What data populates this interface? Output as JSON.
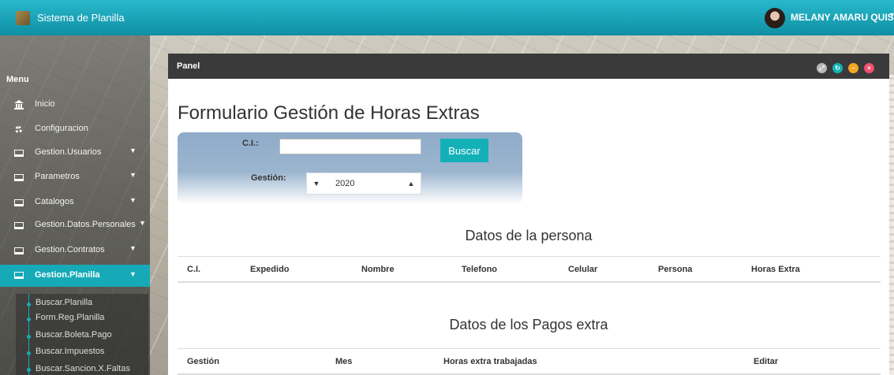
{
  "app": {
    "title": "Sistema de Planilla"
  },
  "user": {
    "name": "MELANY AMARU QUISPE"
  },
  "sidebar": {
    "heading": "Menu",
    "items": [
      {
        "label": "Inicio",
        "icon": "bank-icon",
        "has_caret": false
      },
      {
        "label": "Configuracion",
        "icon": "gear-icon",
        "has_caret": false
      },
      {
        "label": "Gestion.Usuarios",
        "icon": "laptop-icon",
        "has_caret": true
      },
      {
        "label": "Parametros",
        "icon": "laptop-icon",
        "has_caret": true
      },
      {
        "label": "Catalogos",
        "icon": "laptop-icon",
        "has_caret": true
      },
      {
        "label": "Gestion.Datos.Personales",
        "icon": "laptop-icon",
        "has_caret": true
      },
      {
        "label": "Gestion.Contratos",
        "icon": "laptop-icon",
        "has_caret": true
      },
      {
        "label": "Gestion.Planilla",
        "icon": "laptop-icon",
        "has_caret": true,
        "active": true
      }
    ],
    "subitems": [
      "Buscar.Planilla",
      "Form.Reg.Planilla",
      "Buscar.Boleta.Pago",
      "Buscar.Impuestos",
      "Buscar.Sancion.X.Faltas"
    ]
  },
  "panel": {
    "title": "Panel",
    "controls": [
      "expand-icon",
      "refresh-icon",
      "minimize-icon",
      "close-icon"
    ]
  },
  "form": {
    "title": "Formulario Gestión de Horas Extras",
    "ci_label": "C.I.:",
    "ci_value": "",
    "search_button": "Buscar",
    "gestion_label": "Gestión:",
    "gestion_value": "2020"
  },
  "persona_section": {
    "title": "Datos de la persona",
    "columns": [
      "C.I.",
      "Expedido",
      "Nombre",
      "Telefono",
      "Celular",
      "Persona",
      "Horas Extra"
    ]
  },
  "pagos_section": {
    "title": "Datos de los Pagos extra",
    "columns": [
      "Gestión",
      "Mes",
      "Horas extra trabajadas",
      "Editar"
    ]
  },
  "colors": {
    "topbar": "#17a2b8",
    "accent": "#16aab8",
    "panel_header": "#3a3a3a"
  }
}
